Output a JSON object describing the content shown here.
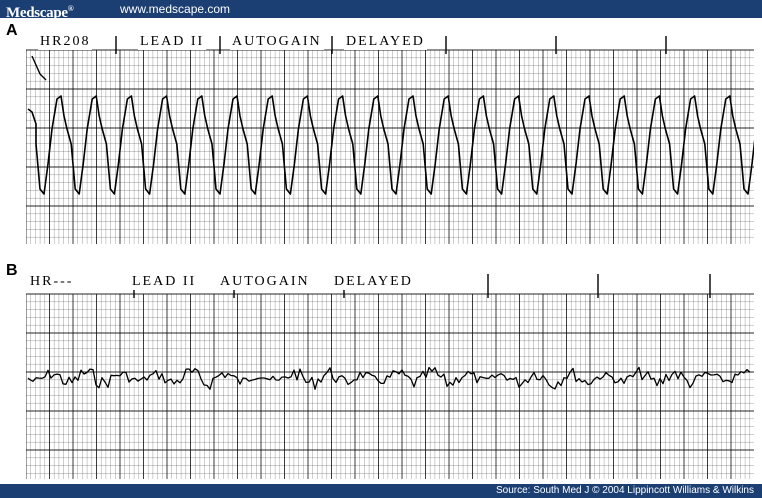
{
  "header": {
    "logo": "Medscape",
    "logo_mark": "®",
    "url": "www.medscape.com"
  },
  "footer": {
    "source": "Source: South Med J © 2004 Lippincott Williams & Wilkins"
  },
  "panels": [
    {
      "label": "A",
      "strip_header": [
        "HR208",
        "LEAD II",
        "AUTOGAIN",
        "DELAYED"
      ]
    },
    {
      "label": "B",
      "strip_header": [
        "HR---",
        "LEAD II",
        "AUTOGAIN",
        "DELAYED"
      ]
    }
  ],
  "colors": {
    "bar": "#1b3f73",
    "grid": "#000000",
    "trace": "#000000"
  }
}
